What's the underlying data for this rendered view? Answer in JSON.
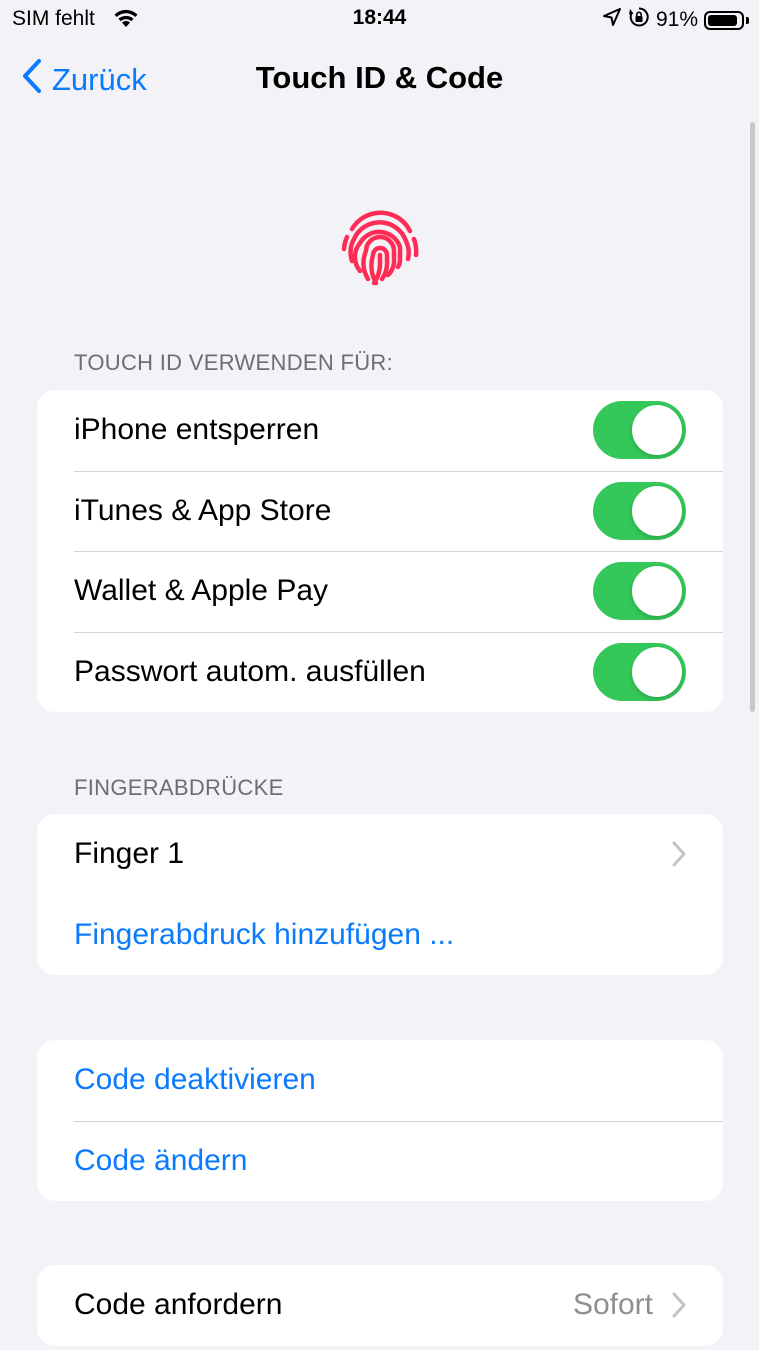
{
  "status_bar": {
    "carrier": "SIM fehlt",
    "time": "18:44",
    "battery_percent": "91%",
    "battery_level": 0.91,
    "icons": [
      "wifi-icon",
      "location-arrow-icon",
      "orientation-lock-icon",
      "battery-icon"
    ]
  },
  "nav": {
    "back_label": "Zurück",
    "title": "Touch ID & Code"
  },
  "hero_icon": "fingerprint-icon",
  "touch_id_section": {
    "header": "TOUCH ID VERWENDEN FÜR:",
    "items": [
      {
        "label": "iPhone entsperren",
        "enabled": true
      },
      {
        "label": "iTunes & App Store",
        "enabled": true
      },
      {
        "label": "Wallet & Apple Pay",
        "enabled": true
      },
      {
        "label": "Passwort autom. ausfüllen",
        "enabled": true
      }
    ]
  },
  "fingerprints_section": {
    "header": "FINGERABDRÜCKE",
    "finger": "Finger 1",
    "add_label": "Fingerabdruck hinzufügen ..."
  },
  "code_section": {
    "deactivate_label": "Code deaktivieren",
    "change_label": "Code ändern"
  },
  "require_code": {
    "label": "Code anfordern",
    "value": "Sofort"
  },
  "colors": {
    "background": "#f2f2f7",
    "accent": "#0a7aff",
    "toggle_on": "#34c759",
    "fingerprint": "#ff2d55",
    "secondary_text": "#8e8e93"
  }
}
